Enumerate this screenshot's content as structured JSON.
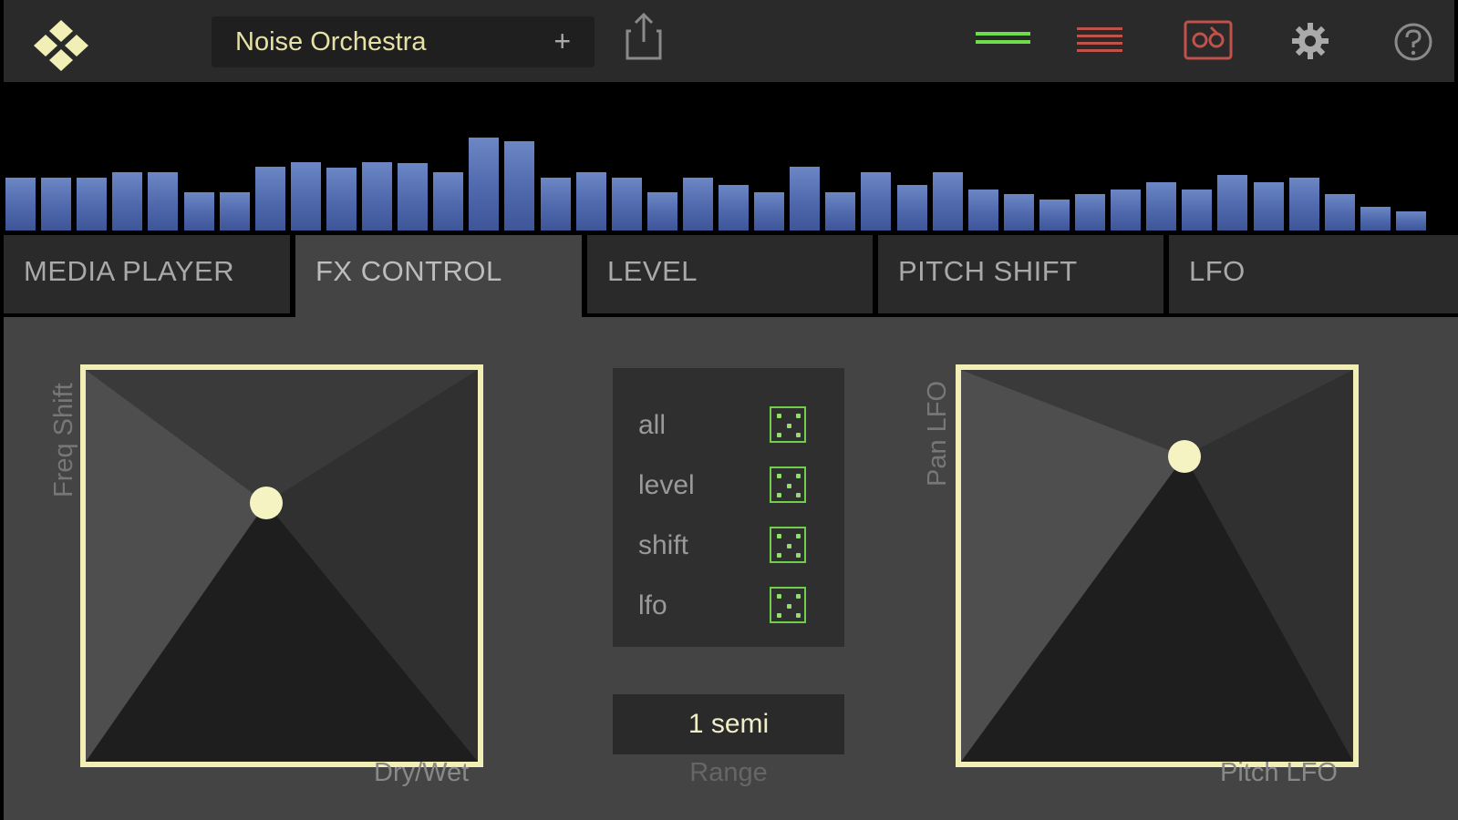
{
  "header": {
    "preset_name": "Noise Orchestra",
    "add_label": "+",
    "icons": [
      "logo-icon",
      "share-icon",
      "mixer-green-icon",
      "mixer-red-icon",
      "record-icon",
      "gear-icon",
      "help-icon"
    ],
    "colors": {
      "accent_yellow": "#e6e1a6",
      "green": "#6fcf4a",
      "red": "#c0524a"
    }
  },
  "spectrum": {
    "levels": [
      0.36,
      0.36,
      0.36,
      0.4,
      0.4,
      0.26,
      0.26,
      0.44,
      0.47,
      0.43,
      0.47,
      0.46,
      0.4,
      0.64,
      0.61,
      0.36,
      0.4,
      0.36,
      0.26,
      0.36,
      0.31,
      0.26,
      0.44,
      0.26,
      0.4,
      0.31,
      0.4,
      0.28,
      0.25,
      0.21,
      0.25,
      0.28,
      0.33,
      0.28,
      0.38,
      0.33,
      0.36,
      0.25,
      0.16,
      0.13
    ],
    "color": "#5671b4"
  },
  "tabs": [
    {
      "label": "MEDIA PLAYER",
      "active": false
    },
    {
      "label": "FX CONTROL",
      "active": true
    },
    {
      "label": "LEVEL",
      "active": false
    },
    {
      "label": "PITCH SHIFT",
      "active": false
    },
    {
      "label": "LFO",
      "active": false
    }
  ],
  "fx": {
    "left_pad": {
      "y_label": "Freq Shift",
      "x_label": "Dry/Wet",
      "x_value": 0.46,
      "y_value": 0.66
    },
    "right_pad": {
      "y_label": "Pan LFO",
      "x_label": "Pitch LFO",
      "x_value": 0.57,
      "y_value": 0.78
    },
    "randomize": [
      {
        "label": "all"
      },
      {
        "label": "level"
      },
      {
        "label": "shift"
      },
      {
        "label": "lfo"
      }
    ],
    "range_value": "1 semi",
    "range_label": "Range"
  }
}
